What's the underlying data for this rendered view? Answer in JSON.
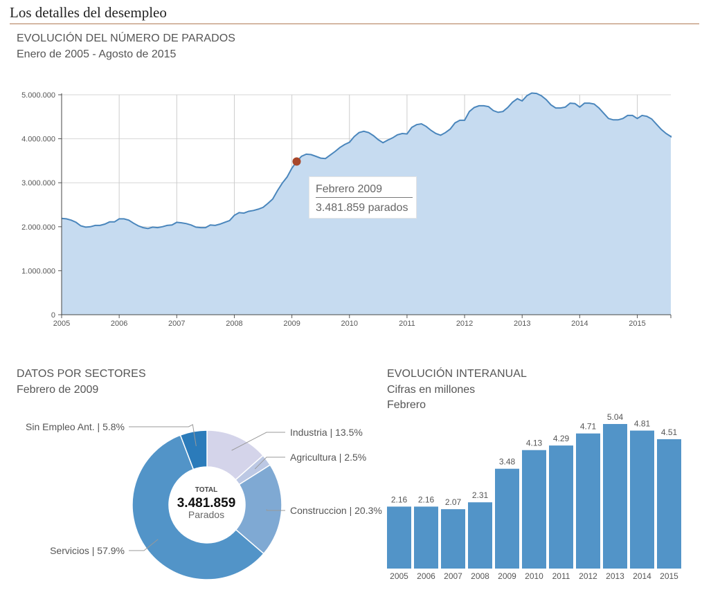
{
  "header": {
    "title": "Los detalles del desempleo"
  },
  "line_section": {
    "title": "EVOLUCIÓN DEL NÚMERO DE PARADOS",
    "subtitle": "Enero de 2005 - Agosto de 2015",
    "tooltip": {
      "month": "Febrero 2009",
      "value": "3.481.859 parados"
    }
  },
  "donut_section": {
    "title": "DATOS POR SECTORES",
    "subtitle": "Febrero de 2009",
    "center": {
      "label": "TOTAL",
      "total": "3.481.859",
      "unit": "Parados"
    }
  },
  "bar_section": {
    "title": "EVOLUCIÓN INTERANUAL",
    "subtitle1": "Cifras en millones",
    "subtitle2": "Febrero"
  },
  "colors": {
    "line": "#4a86bc",
    "area": "#c6dbf0",
    "marker": "#a8472a",
    "bar": "#5294c8",
    "slices": [
      "#d4d4ea",
      "#bcc8e4",
      "#7fa9d3",
      "#5294c8",
      "#2b7bba"
    ]
  },
  "chart_data": [
    {
      "type": "area",
      "x_ticks": [
        "2005",
        "2006",
        "2007",
        "2008",
        "2009",
        "2010",
        "2011",
        "2012",
        "2013",
        "2014",
        "2015"
      ],
      "y_ticks": [
        "0",
        "1.000.000",
        "2.000.000",
        "3.000.000",
        "4.000.000",
        "5.000.000"
      ],
      "ylim": [
        0,
        5000000
      ],
      "xlim": [
        2005.0,
        2015.583
      ],
      "grid": true,
      "highlight": {
        "x": 2009.083,
        "y": 3481859
      },
      "points": [
        [
          2005.0,
          2190000
        ],
        [
          2005.083,
          2180000
        ],
        [
          2005.167,
          2150000
        ],
        [
          2005.25,
          2100000
        ],
        [
          2005.333,
          2020000
        ],
        [
          2005.417,
          1990000
        ],
        [
          2005.5,
          2000000
        ],
        [
          2005.583,
          2030000
        ],
        [
          2005.667,
          2030000
        ],
        [
          2005.75,
          2060000
        ],
        [
          2005.833,
          2110000
        ],
        [
          2005.917,
          2110000
        ],
        [
          2006.0,
          2180000
        ],
        [
          2006.083,
          2180000
        ],
        [
          2006.167,
          2150000
        ],
        [
          2006.25,
          2080000
        ],
        [
          2006.333,
          2020000
        ],
        [
          2006.417,
          1980000
        ],
        [
          2006.5,
          1960000
        ],
        [
          2006.583,
          1990000
        ],
        [
          2006.667,
          1980000
        ],
        [
          2006.75,
          2000000
        ],
        [
          2006.833,
          2030000
        ],
        [
          2006.917,
          2040000
        ],
        [
          2007.0,
          2100000
        ],
        [
          2007.083,
          2090000
        ],
        [
          2007.167,
          2070000
        ],
        [
          2007.25,
          2040000
        ],
        [
          2007.333,
          1990000
        ],
        [
          2007.417,
          1980000
        ],
        [
          2007.5,
          1980000
        ],
        [
          2007.583,
          2040000
        ],
        [
          2007.667,
          2030000
        ],
        [
          2007.75,
          2060000
        ],
        [
          2007.833,
          2100000
        ],
        [
          2007.917,
          2140000
        ],
        [
          2008.0,
          2260000
        ],
        [
          2008.083,
          2320000
        ],
        [
          2008.167,
          2310000
        ],
        [
          2008.25,
          2350000
        ],
        [
          2008.333,
          2370000
        ],
        [
          2008.417,
          2400000
        ],
        [
          2008.5,
          2440000
        ],
        [
          2008.583,
          2530000
        ],
        [
          2008.667,
          2630000
        ],
        [
          2008.75,
          2820000
        ],
        [
          2008.833,
          2990000
        ],
        [
          2008.917,
          3130000
        ],
        [
          2009.0,
          3330000
        ],
        [
          2009.083,
          3481859
        ],
        [
          2009.167,
          3600000
        ],
        [
          2009.25,
          3650000
        ],
        [
          2009.333,
          3640000
        ],
        [
          2009.417,
          3600000
        ],
        [
          2009.5,
          3560000
        ],
        [
          2009.583,
          3550000
        ],
        [
          2009.667,
          3630000
        ],
        [
          2009.75,
          3710000
        ],
        [
          2009.833,
          3800000
        ],
        [
          2009.917,
          3870000
        ],
        [
          2010.0,
          3920000
        ],
        [
          2010.083,
          4050000
        ],
        [
          2010.167,
          4140000
        ],
        [
          2010.25,
          4170000
        ],
        [
          2010.333,
          4140000
        ],
        [
          2010.417,
          4070000
        ],
        [
          2010.5,
          3980000
        ],
        [
          2010.583,
          3910000
        ],
        [
          2010.667,
          3970000
        ],
        [
          2010.75,
          4020000
        ],
        [
          2010.833,
          4090000
        ],
        [
          2010.917,
          4120000
        ],
        [
          2011.0,
          4110000
        ],
        [
          2011.083,
          4260000
        ],
        [
          2011.167,
          4320000
        ],
        [
          2011.25,
          4340000
        ],
        [
          2011.333,
          4280000
        ],
        [
          2011.417,
          4190000
        ],
        [
          2011.5,
          4120000
        ],
        [
          2011.583,
          4080000
        ],
        [
          2011.667,
          4140000
        ],
        [
          2011.75,
          4220000
        ],
        [
          2011.833,
          4360000
        ],
        [
          2011.917,
          4420000
        ],
        [
          2012.0,
          4420000
        ],
        [
          2012.083,
          4620000
        ],
        [
          2012.167,
          4710000
        ],
        [
          2012.25,
          4750000
        ],
        [
          2012.333,
          4750000
        ],
        [
          2012.417,
          4730000
        ],
        [
          2012.5,
          4640000
        ],
        [
          2012.583,
          4600000
        ],
        [
          2012.667,
          4620000
        ],
        [
          2012.75,
          4710000
        ],
        [
          2012.833,
          4830000
        ],
        [
          2012.917,
          4910000
        ],
        [
          2013.0,
          4860000
        ],
        [
          2013.083,
          4980000
        ],
        [
          2013.167,
          5040000
        ],
        [
          2013.25,
          5030000
        ],
        [
          2013.333,
          4980000
        ],
        [
          2013.417,
          4890000
        ],
        [
          2013.5,
          4770000
        ],
        [
          2013.583,
          4700000
        ],
        [
          2013.667,
          4700000
        ],
        [
          2013.75,
          4720000
        ],
        [
          2013.833,
          4810000
        ],
        [
          2013.917,
          4800000
        ],
        [
          2014.0,
          4720000
        ],
        [
          2014.083,
          4810000
        ],
        [
          2014.167,
          4810000
        ],
        [
          2014.25,
          4790000
        ],
        [
          2014.333,
          4700000
        ],
        [
          2014.417,
          4580000
        ],
        [
          2014.5,
          4460000
        ],
        [
          2014.583,
          4430000
        ],
        [
          2014.667,
          4430000
        ],
        [
          2014.75,
          4460000
        ],
        [
          2014.833,
          4530000
        ],
        [
          2014.917,
          4530000
        ],
        [
          2015.0,
          4460000
        ],
        [
          2015.083,
          4530000
        ],
        [
          2015.167,
          4510000
        ],
        [
          2015.25,
          4450000
        ],
        [
          2015.333,
          4330000
        ],
        [
          2015.417,
          4210000
        ],
        [
          2015.5,
          4120000
        ],
        [
          2015.583,
          4050000
        ],
        [
          2015.667,
          4070000
        ]
      ]
    },
    {
      "type": "pie",
      "donut": true,
      "slices": [
        {
          "label": "Industria | 13.5%",
          "value": 13.5
        },
        {
          "label": "Agricultura | 2.5%",
          "value": 2.5
        },
        {
          "label": "Construccion | 20.3%",
          "value": 20.3
        },
        {
          "label": "Servicios | 57.9%",
          "value": 57.9
        },
        {
          "label": "Sin Empleo Ant. | 5.8%",
          "value": 5.8
        }
      ]
    },
    {
      "type": "bar",
      "categories": [
        "2005",
        "2006",
        "2007",
        "2008",
        "2009",
        "2010",
        "2011",
        "2012",
        "2013",
        "2014",
        "2015"
      ],
      "values": [
        2.16,
        2.16,
        2.07,
        2.31,
        3.48,
        4.13,
        4.29,
        4.71,
        5.04,
        4.81,
        4.51
      ],
      "labels": [
        "2.16",
        "2.16",
        "2.07",
        "2.31",
        "3.48",
        "4.13",
        "4.29",
        "4.71",
        "5.04",
        "4.81",
        "4.51"
      ],
      "ylim": [
        0,
        5.04
      ]
    }
  ]
}
